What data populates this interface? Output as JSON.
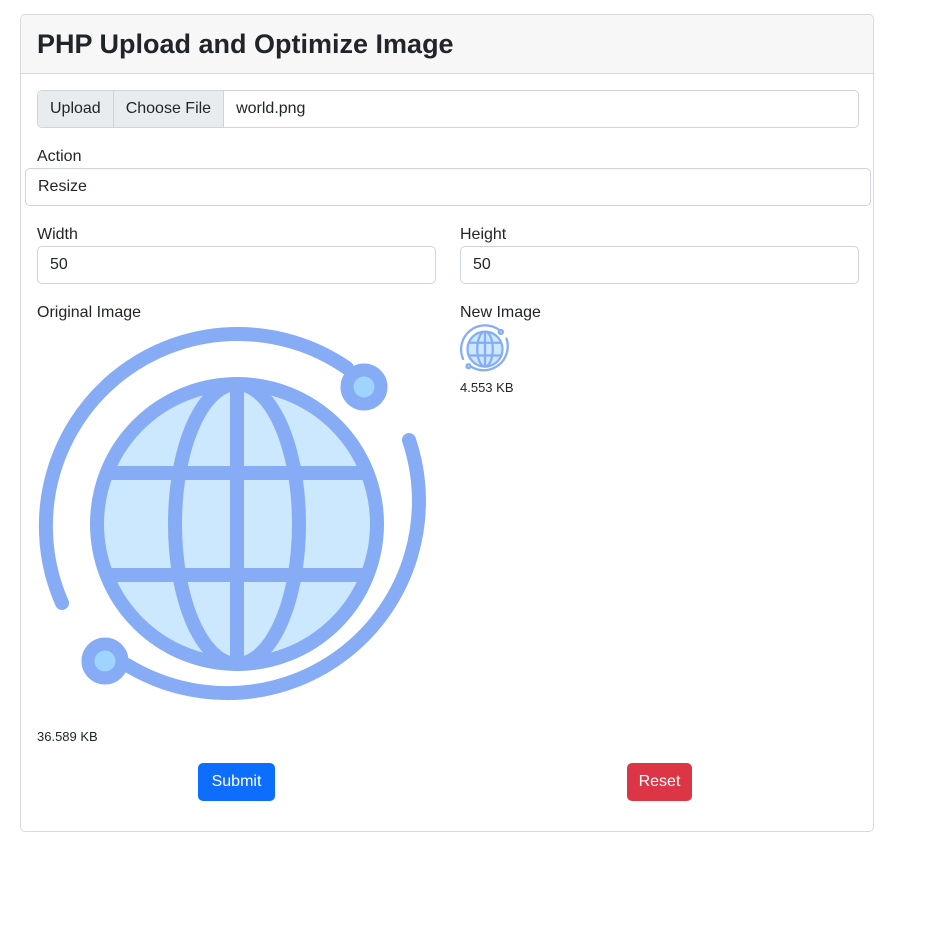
{
  "card": {
    "title": "PHP Upload and Optimize Image"
  },
  "upload": {
    "upload_label": "Upload",
    "choose_label": "Choose File",
    "file_name": "world.png"
  },
  "action": {
    "label": "Action",
    "value": "Resize"
  },
  "width": {
    "label": "Width",
    "value": "50"
  },
  "height": {
    "label": "Height",
    "value": "50"
  },
  "original": {
    "label": "Original Image",
    "size": "36.589 KB",
    "icon": "globe-icon"
  },
  "new_image": {
    "label": "New Image",
    "size": "4.553 KB",
    "icon": "globe-icon"
  },
  "buttons": {
    "submit_label": "Submit",
    "reset_label": "Reset"
  },
  "colors": {
    "globe_stroke": "#86acf5",
    "globe_fill": "#cbe8ff",
    "dot_fill": "#9fd4ff",
    "primary": "#0d6efd",
    "danger": "#dc3545"
  }
}
